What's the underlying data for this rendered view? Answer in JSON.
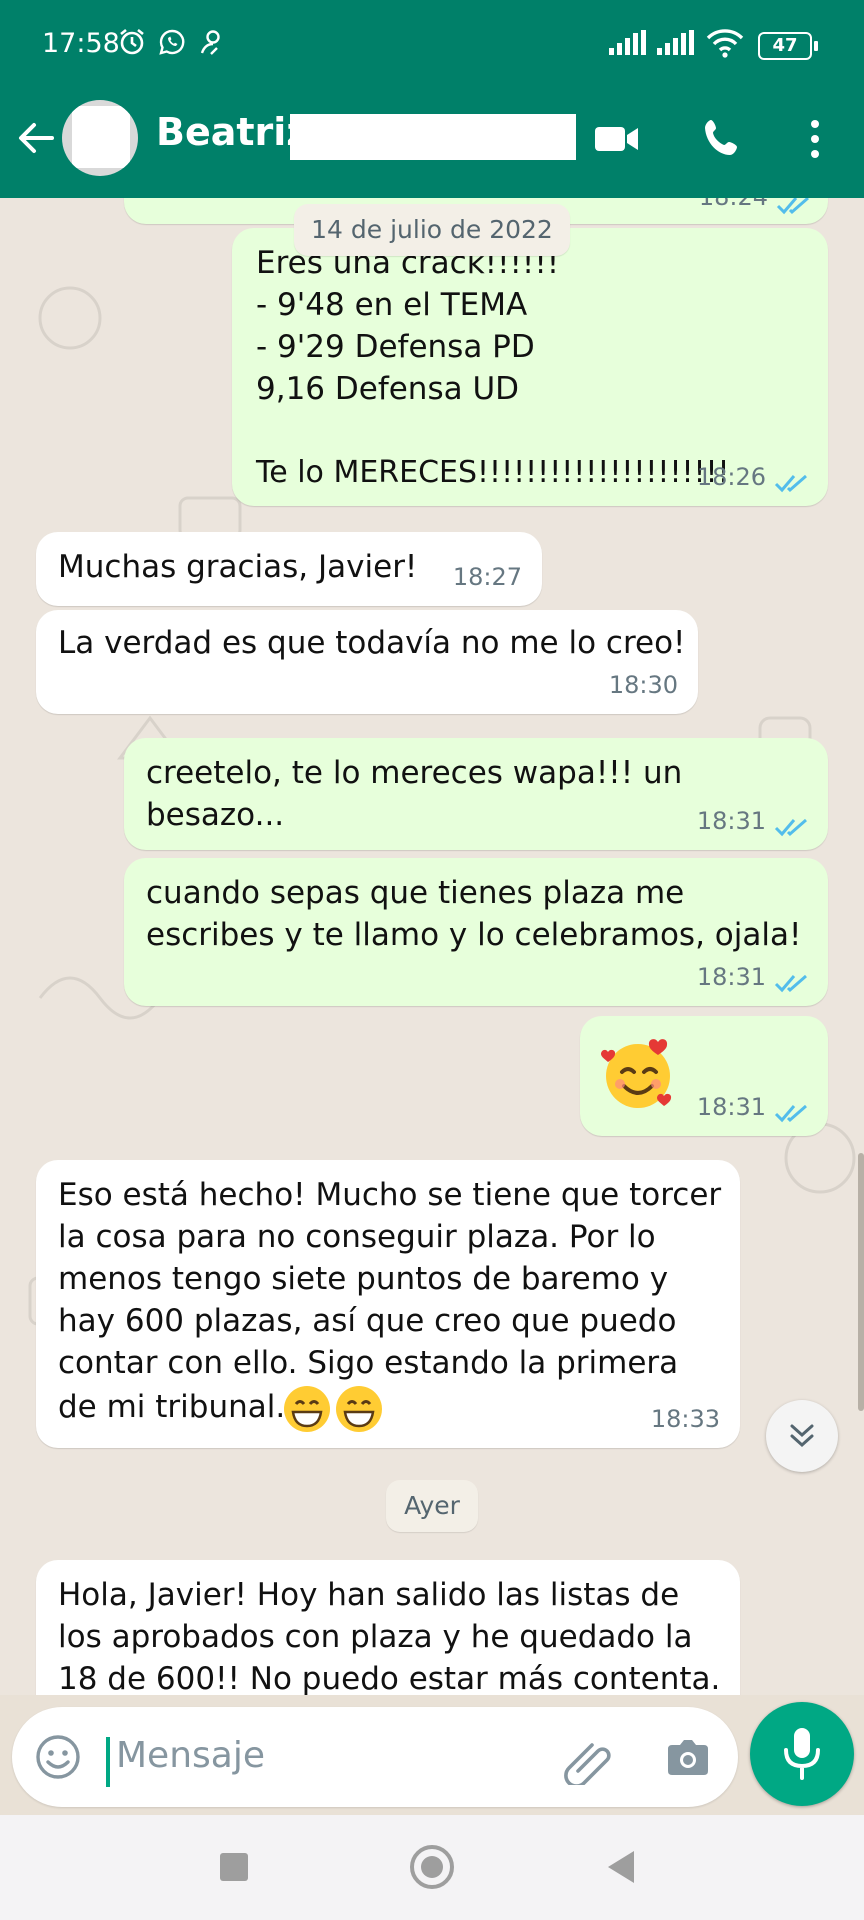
{
  "status_bar": {
    "time": "17:58",
    "battery": "47"
  },
  "header": {
    "contact_name": "Beatriz"
  },
  "chat": {
    "date_chip_1": "14 de julio de 2022",
    "prev_out_time": "18:24",
    "messages": [
      {
        "dir": "out",
        "lines": [
          "Eres una crack!!!!!!",
          "- 9'48 en el TEMA",
          "- 9'29 Defensa PD",
          "9,16 Defensa UD",
          "",
          "Te lo MERECES!!!!!!!!!!!!!!!!!!!!!"
        ],
        "time": "18:26",
        "read": true
      },
      {
        "dir": "in",
        "lines": [
          "Muchas gracias, Javier!"
        ],
        "time": "18:27"
      },
      {
        "dir": "in",
        "lines": [
          "La verdad es que todavía no me lo creo!"
        ],
        "time": "18:30"
      },
      {
        "dir": "out",
        "lines": [
          "creetelo, te lo mereces wapa!!! un",
          "besazo..."
        ],
        "time": "18:31",
        "read": true
      },
      {
        "dir": "out",
        "lines": [
          "cuando sepas que tienes plaza me",
          "escribes y te llamo y lo celebramos, ojala!"
        ],
        "time": "18:31",
        "read": true
      },
      {
        "dir": "out",
        "emoji": "smiling-face-with-hearts",
        "time": "18:31",
        "read": true
      },
      {
        "dir": "in",
        "lines": [
          "Eso está hecho! Mucho se tiene que torcer",
          "la cosa para no conseguir plaza. Por lo",
          "menos tengo siete puntos de baremo y",
          "hay 600 plazas, así que creo que puedo",
          "contar con ello. Sigo estando la primera",
          "de mi tribunal."
        ],
        "emoji_suffix": "grinning-face x2",
        "time": "18:33"
      },
      {
        "dir": "in",
        "lines": [
          "Hola, Javier! Hoy han salido las listas de",
          "los aprobados con plaza y he quedado la",
          "18 de 600!! No puedo estar más contenta."
        ],
        "partial": true
      }
    ],
    "date_chip_2": "Ayer"
  },
  "input": {
    "placeholder": "Mensaje"
  },
  "colors": {
    "header": "#008069",
    "outgoing": "#e7ffdb",
    "incoming": "#ffffff",
    "accent": "#00a884",
    "read_ticks": "#53bdeb",
    "wallpaper": "#ece5dd"
  },
  "icons": [
    "back-arrow-icon",
    "video-call-icon",
    "phone-icon",
    "more-vert-icon",
    "emoji-icon",
    "attach-icon",
    "camera-icon",
    "mic-icon",
    "scroll-down-icon",
    "nav-recent-icon",
    "nav-home-icon",
    "nav-back-icon"
  ]
}
